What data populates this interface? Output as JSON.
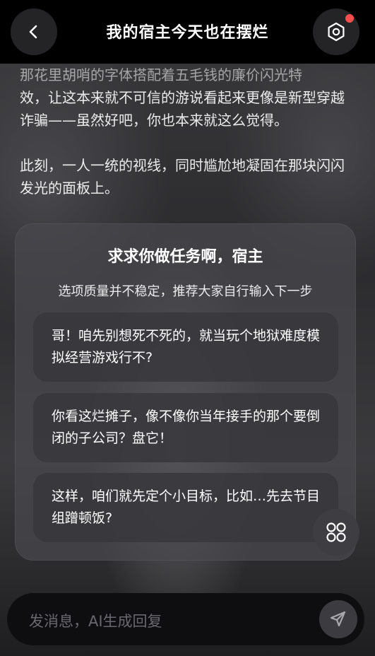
{
  "header": {
    "title": "我的宿主今天也在摆烂"
  },
  "story": {
    "lines_faded": "那花里胡哨的字体搭配着五毛钱的廉价闪光特",
    "paragraph1_rest": "效，让这本来就不可信的游说看起来更像是新型穿越诈骗——虽然好吧，你也本来就这么觉得。",
    "paragraph2": "此刻，一人一统的视线，同时尴尬地凝固在那块闪闪发光的面板上。"
  },
  "choices": {
    "title": "求求你做任务啊，宿主",
    "subtitle": "选项质量并不稳定，推荐大家自行输入下一步",
    "options": [
      {
        "text": "哥！咱先别想死不死的，就当玩个地狱难度模拟经营游戏行不?"
      },
      {
        "text": "你看这烂摊子，像不像你当年接手的那个要倒闭的子公司？盘它！"
      },
      {
        "text": "这样，咱们就先定个小目标，比如…先去节目组蹭顿饭?"
      }
    ]
  },
  "composer": {
    "placeholder": "发消息，AI生成回复"
  },
  "colors": {
    "accent_dot": "#ff4d4d",
    "header_bg": "#000000",
    "card_bg": "#48484e"
  },
  "icons": {
    "back": "chevron-left-icon",
    "settings": "hexagon-gear-icon",
    "menu": "grid-circles-icon",
    "send": "paper-plane-icon"
  }
}
